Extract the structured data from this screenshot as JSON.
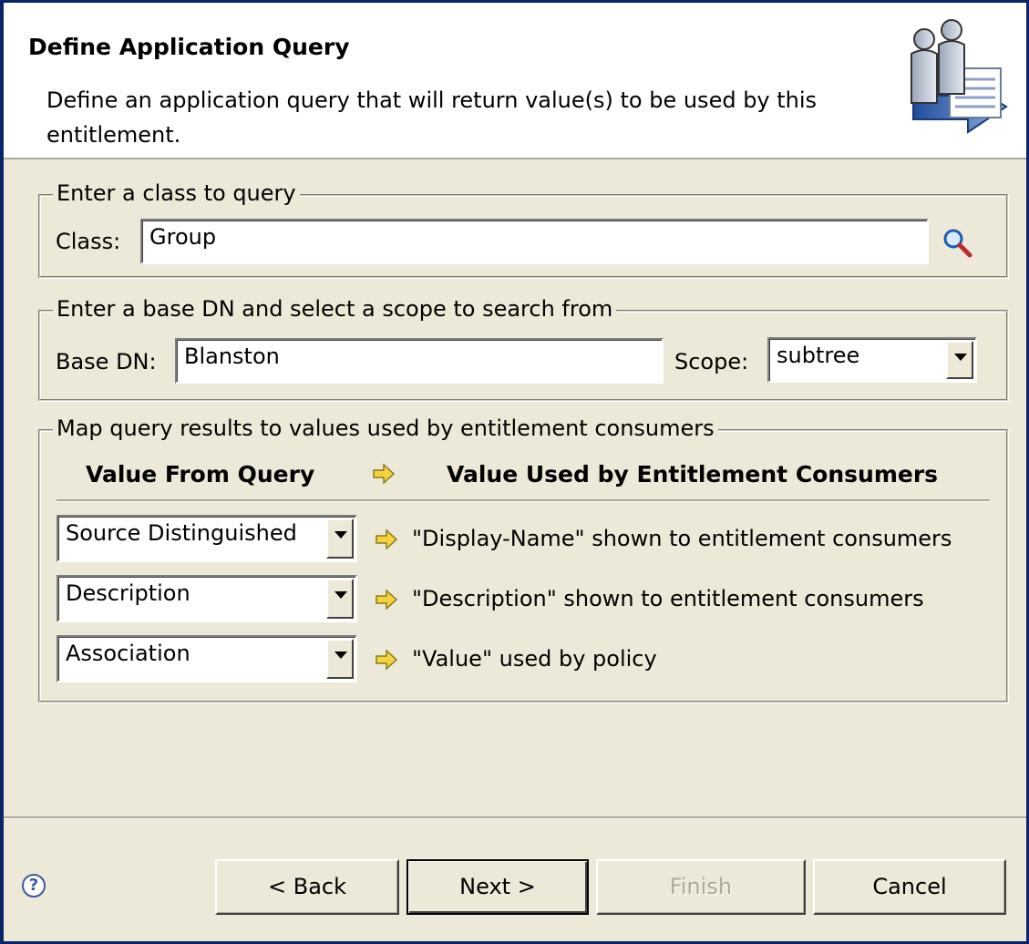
{
  "header": {
    "title": "Define Application Query",
    "description": "Define an application query that will return value(s) to be used by this entitlement."
  },
  "class_group": {
    "legend": "Enter a class to query",
    "class_label": "Class:",
    "class_value": "Group",
    "search_icon": "magnifier-icon"
  },
  "dn_group": {
    "legend": "Enter a base DN and select a scope to search from",
    "base_dn_label": "Base DN:",
    "base_dn_value": "Blanston",
    "scope_label": "Scope:",
    "scope_value": "subtree"
  },
  "map_group": {
    "legend": "Map query results to values used by entitlement consumers",
    "col_from": "Value From Query",
    "col_to": "Value Used by Entitlement Consumers",
    "rows": [
      {
        "from": "Source Distinguished",
        "to": "\"Display-Name\" shown to entitlement consumers"
      },
      {
        "from": "Description",
        "to": "\"Description\" shown to entitlement consumers"
      },
      {
        "from": "Association",
        "to": "\"Value\" used by policy"
      }
    ]
  },
  "buttons": {
    "back": "< Back",
    "next": "Next >",
    "finish": "Finish",
    "cancel": "Cancel"
  },
  "colors": {
    "arrow": "#f5d33b",
    "window_border": "#0a246a",
    "face": "#ece9d8"
  }
}
